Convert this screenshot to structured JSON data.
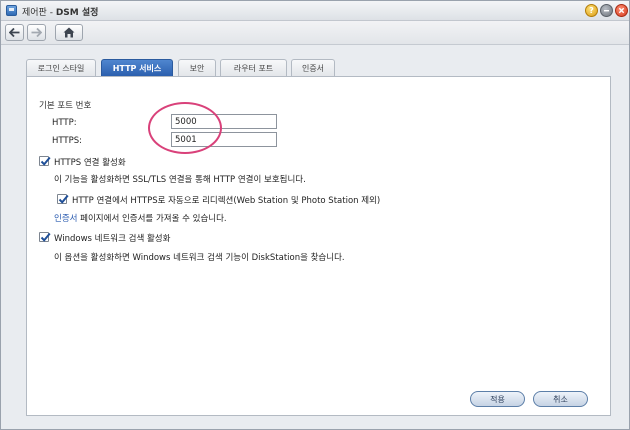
{
  "window": {
    "title_prefix": "제어판 - ",
    "title_main": "DSM 설정",
    "help_label": "?"
  },
  "tabs": [
    {
      "label": "로그인 스타일"
    },
    {
      "label": "HTTP 서비스"
    },
    {
      "label": "보안"
    },
    {
      "label": "라우터 포트"
    },
    {
      "label": "인증서"
    }
  ],
  "panel": {
    "section_title": "기본 포트 번호",
    "http_label": "HTTP:",
    "http_value": "5000",
    "https_label": "HTTPS:",
    "https_value": "5001",
    "https_enable_label": "HTTPS 연결 활성화",
    "https_enable_checked": true,
    "https_desc": "이 기능을 활성화하면 SSL/TLS 연결을 통해 HTTP 연결이 보호됩니다.",
    "redirect_label": "HTTP 연결에서 HTTPS로 자동으로 리디렉션(Web Station 및 Photo Station 제외)",
    "redirect_checked": true,
    "cert_link": "인증서",
    "cert_desc": " 페이지에서 인증서를 가져올 수 있습니다.",
    "windows_discovery_label": "Windows 네트워크 검색 활성화",
    "windows_discovery_checked": true,
    "windows_discovery_desc": "이 옵션을 활성화하면 Windows 네트워크 검색 기능이 DiskStation을 찾습니다."
  },
  "buttons": {
    "apply": "적용",
    "cancel": "취소"
  },
  "colors": {
    "active_tab": "#2b5fae",
    "annotation": "#d9417a",
    "link": "#2a5bb0"
  }
}
